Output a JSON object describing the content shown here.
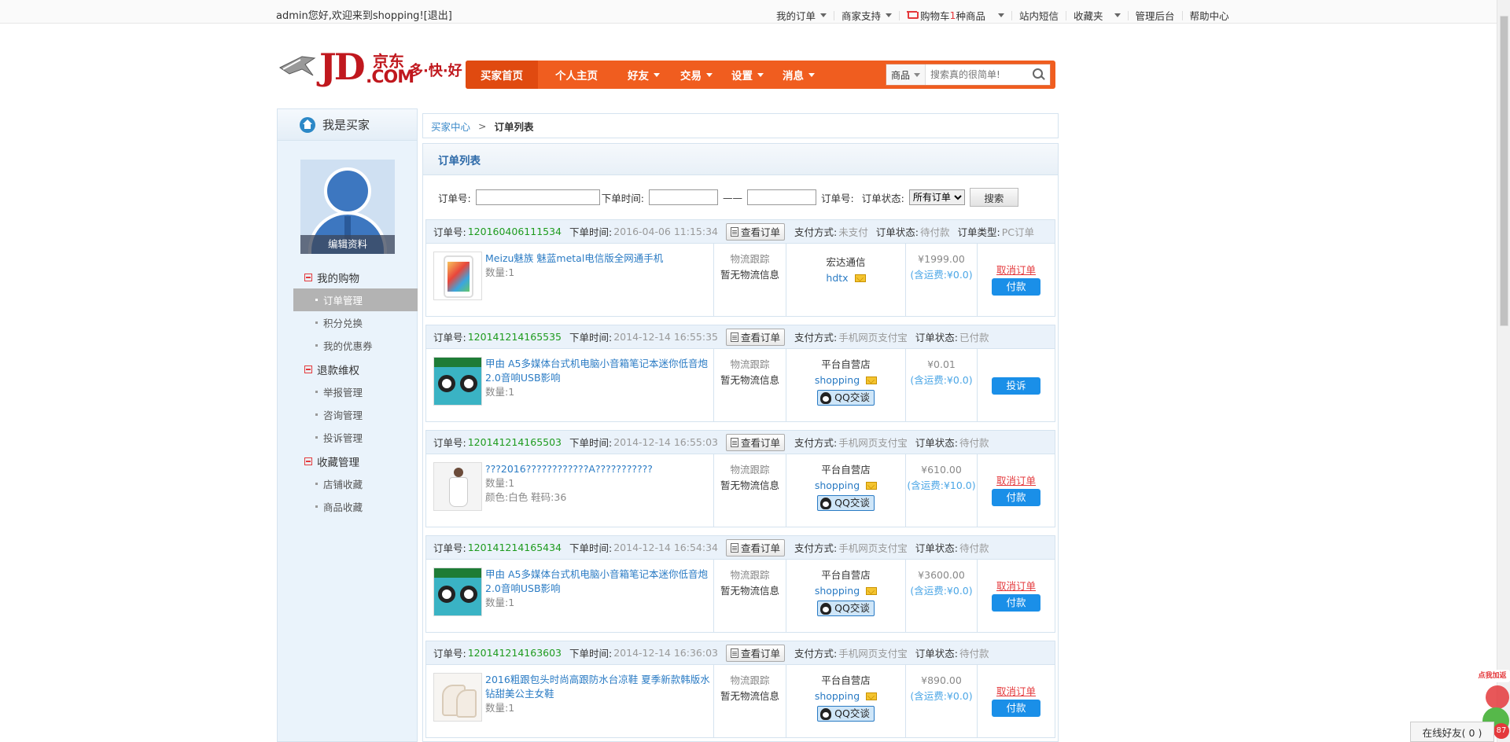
{
  "topbar": {
    "welcome": "admin您好,欢迎来到shopping!",
    "logout": "[退出]",
    "nav": [
      {
        "label": "我的订单",
        "dropdown": true
      },
      {
        "label": "商家支持",
        "dropdown": true
      },
      {
        "label_pre": "购物车",
        "label_num": "1",
        "label_post": "种商品",
        "dropdown": true
      },
      {
        "label": "站内短信",
        "dropdown": false
      },
      {
        "label": "收藏夹",
        "dropdown": true
      },
      {
        "label": "管理后台",
        "dropdown": false
      },
      {
        "label": "帮助中心",
        "dropdown": false
      }
    ]
  },
  "logo": {
    "jd": "JD",
    "cn": "京东",
    "com": ".COM",
    "slogan": "多·快·好"
  },
  "mainnav": {
    "items": [
      "买家首页",
      "个人主页",
      "好友",
      "交易",
      "设置",
      "消息"
    ],
    "search_category": "商品",
    "search_placeholder": "搜索真的很简单!"
  },
  "sidebar": {
    "title": "我是买家",
    "edit_profile": "编辑资料",
    "groups": [
      {
        "label": "我的购物",
        "items": [
          "订单管理",
          "积分兑换",
          "我的优惠券"
        ]
      },
      {
        "label": "退款维权",
        "items": [
          "举报管理",
          "咨询管理",
          "投诉管理"
        ]
      },
      {
        "label": "收藏管理",
        "items": [
          "店铺收藏",
          "商品收藏"
        ]
      }
    ]
  },
  "breadcrumb": {
    "parent": "买家中心",
    "sep": ">",
    "current": "订单列表"
  },
  "panel": {
    "title": "订单列表",
    "filter": {
      "order_no_label": "订单号:",
      "time_label": "下单时间:",
      "dash": "——",
      "order_no_label2": "订单号:",
      "status_label": "订单状态:",
      "status_value": "所有订单",
      "search_btn": "搜索"
    }
  },
  "labels": {
    "order_no": "订单号:",
    "order_time": "下单时间:",
    "view": "查看订单",
    "pay_method": "支付方式:",
    "order_status": "订单状态:",
    "order_type": "订单类型:",
    "logistics_title": "物流跟踪",
    "logistics_none": "暂无物流信息",
    "qq": "QQ交谈",
    "cancel": "取消订单",
    "pay": "付款",
    "complain": "投诉"
  },
  "orders": [
    {
      "no": "120160406111534",
      "time": "2016-04-06 11:15:34",
      "pay": "未支付",
      "status": "待付款",
      "type": "PC订单",
      "product": "Meizu魅族 魅蓝metal电信版全网通手机",
      "qty": "数量:1",
      "extra": "",
      "shop": "宏达通信",
      "shop_user": "hdtx",
      "price": "¥1999.00",
      "ship": "(含运费:¥0.0)",
      "actions": "cancel-pay",
      "img": "phone"
    },
    {
      "no": "120141214165535",
      "time": "2014-12-14 16:55:35",
      "pay": "手机网页支付宝",
      "status": "已付款",
      "type": "",
      "product": "甲由 A5多媒体台式机电脑小音箱笔记本迷你低音炮2.0音响USB影响",
      "qty": "数量:1",
      "extra": "",
      "shop": "平台自营店",
      "shop_user": "shopping",
      "price": "¥0.01",
      "ship": "(含运费:¥0.0)",
      "actions": "complain",
      "img": "speaker"
    },
    {
      "no": "120141214165503",
      "time": "2014-12-14 16:55:03",
      "pay": "手机网页支付宝",
      "status": "待付款",
      "type": "",
      "product": "???2016????????????A???????????",
      "qty": "数量:1",
      "extra": "颜色:白色 鞋码:36",
      "shop": "平台自营店",
      "shop_user": "shopping",
      "price": "¥610.00",
      "ship": "(含运费:¥10.0)",
      "actions": "cancel-pay",
      "img": "dress"
    },
    {
      "no": "120141214165434",
      "time": "2014-12-14 16:54:34",
      "pay": "手机网页支付宝",
      "status": "待付款",
      "type": "",
      "product": "甲由 A5多媒体台式机电脑小音箱笔记本迷你低音炮2.0音响USB影响",
      "qty": "数量:1",
      "extra": "",
      "shop": "平台自营店",
      "shop_user": "shopping",
      "price": "¥3600.00",
      "ship": "(含运费:¥0.0)",
      "actions": "cancel-pay",
      "img": "speaker"
    },
    {
      "no": "120141214163603",
      "time": "2014-12-14 16:36:03",
      "pay": "手机网页支付宝",
      "status": "待付款",
      "type": "",
      "product": "2016粗跟包头时尚高跟防水台凉鞋 夏季新款韩版水钻甜美公主女鞋",
      "qty": "数量:1",
      "extra": "",
      "shop": "平台自营店",
      "shop_user": "shopping",
      "price": "¥890.00",
      "ship": "(含运费:¥0.0)",
      "actions": "cancel-pay",
      "img": "shoe"
    }
  ],
  "widgets": {
    "online_friends": "在线好友( 0 )",
    "add_me": "点我加返",
    "badge": "87"
  }
}
